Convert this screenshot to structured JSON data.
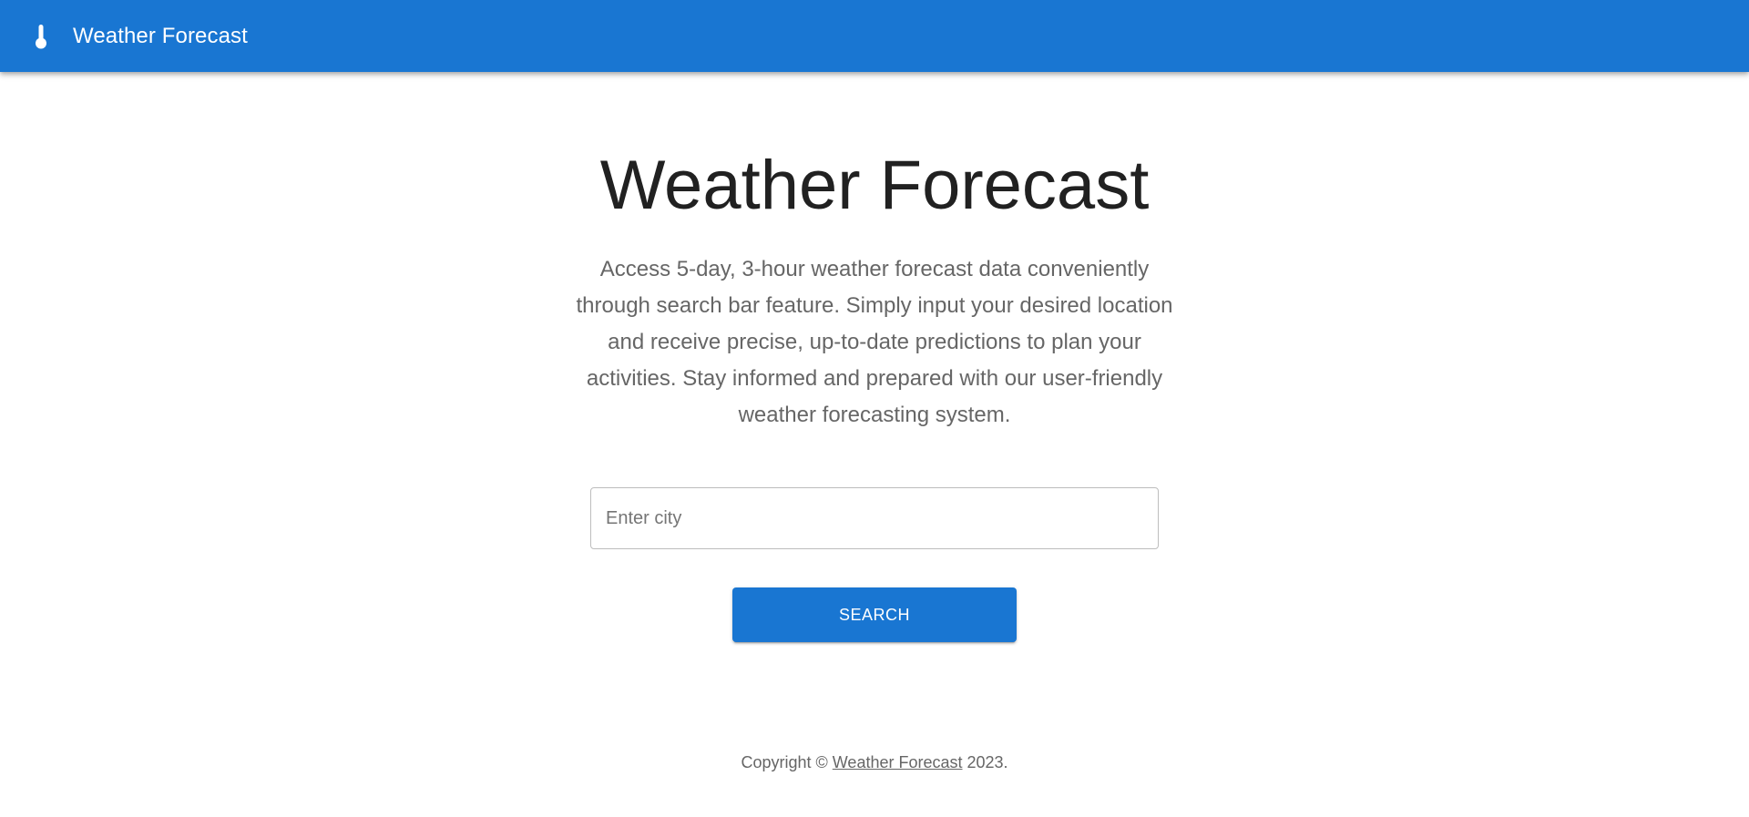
{
  "appbar": {
    "icon": "thermometer-icon",
    "brand": "Weather Forecast",
    "color": "#1976d2"
  },
  "hero": {
    "title": "Weather Forecast",
    "description": "Access 5-day, 3-hour weather forecast data conveniently through search bar feature. Simply input your desired location and receive precise, up-to-date predictions to plan your activities. Stay informed and prepared with our user-friendly weather forecasting system."
  },
  "search": {
    "placeholder": "Enter city",
    "value": "",
    "button_label": "SEARCH"
  },
  "footer": {
    "prefix": "Copyright © ",
    "link_text": "Weather Forecast",
    "suffix": " 2023."
  }
}
